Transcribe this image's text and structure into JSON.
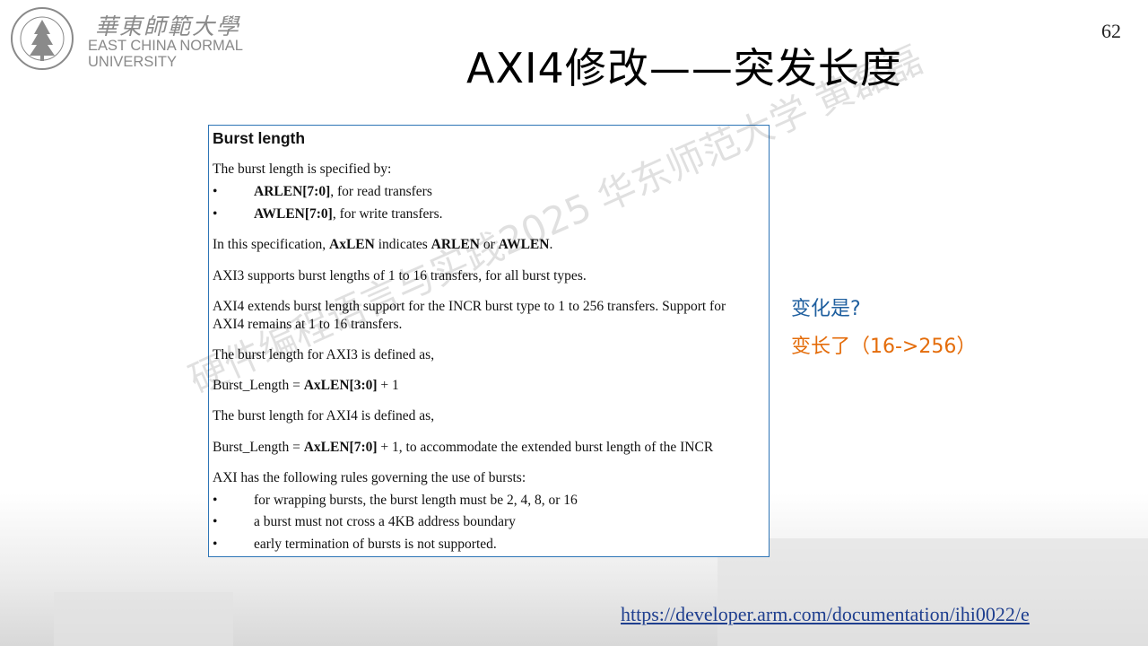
{
  "logo": {
    "cn": "華東師範大學",
    "en_line1": "EAST CHINA NORMAL",
    "en_line2": "UNIVERSITY",
    "seal_text": "EAST CHINA NORMAL UNIVERSITY"
  },
  "page_number": "62",
  "title": "AXI4修改——突发长度",
  "spec": {
    "heading": "Burst length",
    "intro": "The burst length is specified by:",
    "bullet_char": "•",
    "arlen_term": "ARLEN[7:0]",
    "arlen_rest": ", for read transfers",
    "awlen_term": "AWLEN[7:0]",
    "awlen_rest": ", for write transfers.",
    "p_in_this_1": "In this specification, ",
    "p_in_this_axlen": "AxLEN",
    "p_in_this_2": " indicates ",
    "p_in_this_arlen": "ARLEN",
    "p_in_this_3": " or ",
    "p_in_this_awlen": "AWLEN",
    "p_in_this_4": ".",
    "axi3_support": "AXI3 supports burst lengths of 1 to 16 transfers, for all burst types.",
    "axi4_support_1": "AXI4 extends burst length support for the INCR burst type to 1 to 256 transfers. Support for",
    "axi4_support_2": "AXI4 remains at 1 to 16 transfers.",
    "axi3_def": "The burst length for AXI3 is defined as,",
    "axi3_formula_1": "Burst_Length = ",
    "axi3_formula_term": "AxLEN[3:0]",
    "axi3_formula_2": " + 1",
    "axi4_def": "The burst length for AXI4 is defined as,",
    "axi4_formula_1": "Burst_Length = ",
    "axi4_formula_term": "AxLEN[7:0]",
    "axi4_formula_2": " + 1, to accommodate the extended burst length of the INCR",
    "rules_intro": "AXI has the following rules governing the use of bursts:",
    "rules": [
      "for wrapping bursts, the burst length must be 2, 4, 8, or 16",
      "a burst must not cross a 4KB address boundary",
      "early termination of bursts is not supported."
    ]
  },
  "question": "变化是?",
  "answer": "变长了（16->256）",
  "link": "https://developer.arm.com/documentation/ihi0022/e",
  "watermark": "硬件编程语言与实践2025 华东师范大学 黄磊磊",
  "colors": {
    "box_border": "#2e75b6",
    "question": "#1f5f9f",
    "answer": "#e46c0a",
    "link": "#1f3f8f"
  }
}
